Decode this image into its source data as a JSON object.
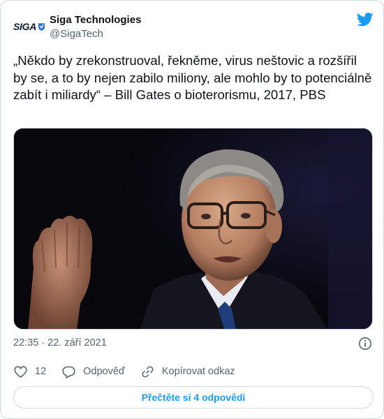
{
  "tweet": {
    "author": {
      "display_name": "Siga Technologies",
      "handle": "@SigaTech",
      "avatar_text": "SIGA",
      "avatar_icon": "siga-logo-icon"
    },
    "text": "„Někdo by zrekonstruoval, řekněme, virus neštovic a rozšířil by se, a to by nejen zabilo miliony, ale mohlo by to potenciálně zabít i miliardy“ – Bill Gates o bioterorismu, 2017, PBS",
    "media": {
      "type": "photo",
      "icon": "photo-image"
    },
    "timestamp": "22:35 · 22. září 2021",
    "actions": {
      "like_count": "12",
      "reply_label": "Odpověď",
      "copy_link_label": "Kopírovat odkaz"
    },
    "read_replies_label": "Přečtěte si 4 odpovědi"
  },
  "icons": {
    "platform": "twitter-bird-icon",
    "info": "info-icon",
    "like": "heart-icon",
    "reply": "reply-icon",
    "link": "link-icon"
  },
  "colors": {
    "twitter_blue": "#1d9bf0",
    "secondary_text": "#536471",
    "border": "#cfd9de",
    "primary_text": "#0f1419"
  }
}
